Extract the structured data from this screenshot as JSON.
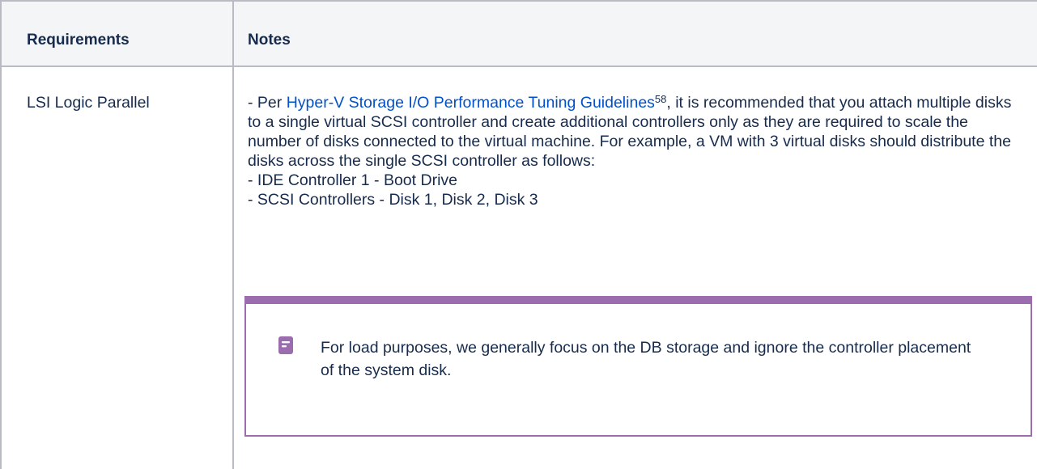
{
  "table": {
    "headers": {
      "requirements": "Requirements",
      "notes": "Notes"
    },
    "rows": [
      {
        "requirement": "LSI Logic Parallel",
        "notes": {
          "intro_prefix": "- Per ",
          "link_text": "Hyper-V Storage I/O Performance Tuning Guidelines",
          "footnote": "58",
          "intro_suffix": ", it is recommended that you attach multiple disks to a single virtual SCSI controller and create additional controllers only as they are required to scale the number of disks connected to the virtual machine. For example, a VM with 3 virtual disks should distribute the disks across the single SCSI controller as follows:",
          "list": [
            "- IDE Controller 1 - Boot Drive",
            "- SCSI Controllers - Disk 1, Disk 2, Disk 3"
          ],
          "note_panel": {
            "icon": "note-icon",
            "text": "For load purposes, we generally focus on the DB storage and ignore the controller placement of the system disk.",
            "accent_color": "#9b6daf"
          }
        }
      }
    ]
  }
}
